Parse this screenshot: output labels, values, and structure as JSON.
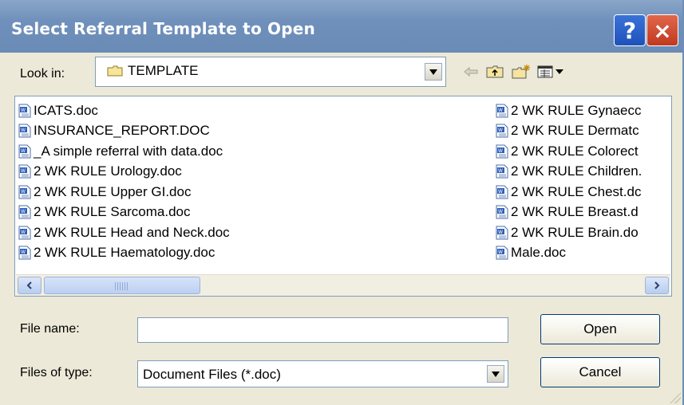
{
  "window": {
    "title": "Select Referral Template to Open"
  },
  "titlebar": {
    "help_glyph": "?",
    "close_glyph": "×"
  },
  "look_in": {
    "label": "Look in:",
    "value": "TEMPLATE"
  },
  "files": {
    "left": [
      "ICATS.doc",
      "INSURANCE_REPORT.DOC",
      "_A simple referral with data.doc",
      "2 WK RULE Urology.doc",
      "2 WK RULE Upper GI.doc",
      "2 WK RULE Sarcoma.doc",
      "2 WK RULE Head and Neck.doc",
      "2 WK RULE Haematology.doc"
    ],
    "right": [
      "2 WK RULE Gynaecc",
      "2 WK RULE Dermatc",
      "2 WK RULE Colorect",
      "2 WK RULE Children.",
      "2 WK RULE Chest.dc",
      "2 WK RULE Breast.d",
      "2 WK RULE Brain.do",
      "Male.doc"
    ]
  },
  "file_name": {
    "label": "File name:",
    "value": ""
  },
  "file_type": {
    "label": "Files of type:",
    "value": "Document Files (*.doc)"
  },
  "buttons": {
    "open": "Open",
    "cancel": "Cancel"
  },
  "colors": {
    "titlebar": "#6f90bb",
    "dialog_bg": "#ece9d8",
    "field_border": "#7f9db9"
  }
}
